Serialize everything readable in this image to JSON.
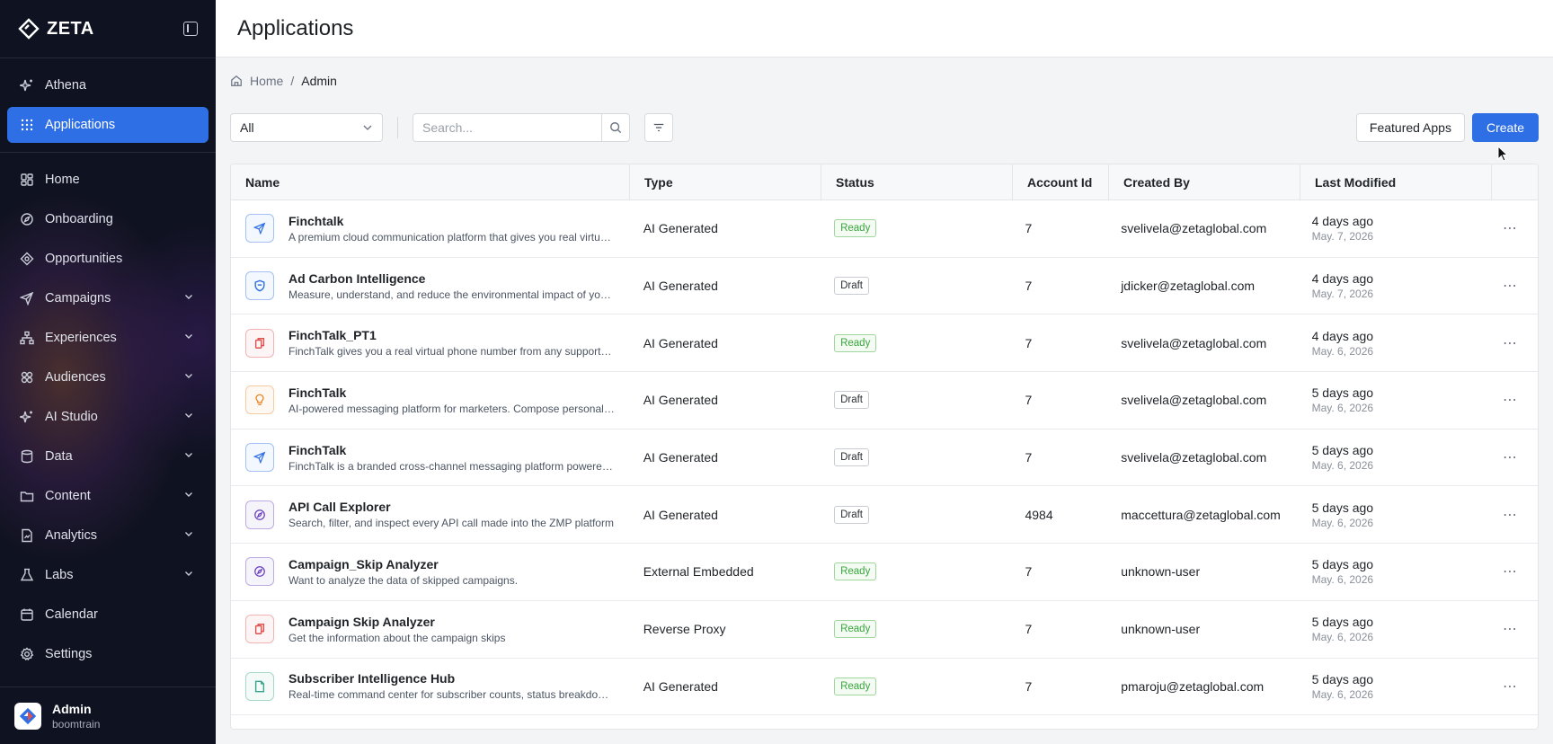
{
  "brand": {
    "name": "ZETA"
  },
  "sidebar": {
    "top_items": [
      {
        "label": "Athena",
        "icon": "sparkle-icon",
        "active": false,
        "chevron": false
      },
      {
        "label": "Applications",
        "icon": "grid-icon",
        "active": true,
        "chevron": false
      }
    ],
    "items": [
      {
        "label": "Home",
        "icon": "dashboard-icon",
        "chevron": false
      },
      {
        "label": "Onboarding",
        "icon": "compass-icon",
        "chevron": false
      },
      {
        "label": "Opportunities",
        "icon": "target-icon",
        "chevron": false
      },
      {
        "label": "Campaigns",
        "icon": "send-icon",
        "chevron": true
      },
      {
        "label": "Experiences",
        "icon": "flow-icon",
        "chevron": true
      },
      {
        "label": "Audiences",
        "icon": "people-icon",
        "chevron": true
      },
      {
        "label": "AI Studio",
        "icon": "sparkle-icon",
        "chevron": true
      },
      {
        "label": "Data",
        "icon": "database-icon",
        "chevron": true
      },
      {
        "label": "Content",
        "icon": "folder-icon",
        "chevron": true
      },
      {
        "label": "Analytics",
        "icon": "report-icon",
        "chevron": true
      },
      {
        "label": "Labs",
        "icon": "labs-icon",
        "chevron": true
      },
      {
        "label": "Calendar",
        "icon": "calendar-icon",
        "chevron": false
      },
      {
        "label": "Settings",
        "icon": "gear-icon",
        "chevron": false
      }
    ],
    "user": {
      "name": "Admin",
      "org": "boomtrain"
    }
  },
  "header": {
    "title": "Applications"
  },
  "breadcrumb": {
    "home": "Home",
    "separator": "/",
    "current": "Admin"
  },
  "toolbar": {
    "filter_value": "All",
    "search_placeholder": "Search...",
    "featured_label": "Featured Apps",
    "create_label": "Create"
  },
  "table": {
    "columns": [
      "Name",
      "Type",
      "Status",
      "Account Id",
      "Created By",
      "Last Modified"
    ],
    "rows": [
      {
        "name": "Finchtalk",
        "desc": "A premium cloud communication platform that gives you real virtual phone numbers",
        "type": "AI Generated",
        "status": "Ready",
        "account": "7",
        "by": "svelivela@zetaglobal.com",
        "rel": "4 days ago",
        "date": "May. 7, 2026",
        "icon": "send-icon",
        "color": "#2f6fe6"
      },
      {
        "name": "Ad Carbon Intelligence",
        "desc": "Measure, understand, and reduce the environmental impact of your advertising",
        "type": "AI Generated",
        "status": "Draft",
        "account": "7",
        "by": "jdicker@zetaglobal.com",
        "rel": "4 days ago",
        "date": "May. 7, 2026",
        "icon": "shield-icon",
        "color": "#2f6fe6"
      },
      {
        "name": "FinchTalk_PT1",
        "desc": "FinchTalk gives you a real virtual phone number from any supported country",
        "type": "AI Generated",
        "status": "Ready",
        "account": "7",
        "by": "svelivela@zetaglobal.com",
        "rel": "4 days ago",
        "date": "May. 6, 2026",
        "icon": "phone-icon",
        "color": "#e0524f"
      },
      {
        "name": "FinchTalk",
        "desc": "AI-powered messaging platform for marketers. Compose personalized messages",
        "type": "AI Generated",
        "status": "Draft",
        "account": "7",
        "by": "svelivela@zetaglobal.com",
        "rel": "5 days ago",
        "date": "May. 6, 2026",
        "icon": "bulb-icon",
        "color": "#e88a2e"
      },
      {
        "name": "FinchTalk",
        "desc": "FinchTalk is a branded cross-channel messaging platform powered by AI",
        "type": "AI Generated",
        "status": "Draft",
        "account": "7",
        "by": "svelivela@zetaglobal.com",
        "rel": "5 days ago",
        "date": "May. 6, 2026",
        "icon": "send-icon",
        "color": "#2f6fe6"
      },
      {
        "name": "API Call Explorer",
        "desc": "Search, filter, and inspect every API call made into the ZMP platform",
        "type": "AI Generated",
        "status": "Draft",
        "account": "4984",
        "by": "maccettura@zetaglobal.com",
        "rel": "5 days ago",
        "date": "May. 6, 2026",
        "icon": "compass-icon",
        "color": "#6a3fc2"
      },
      {
        "name": "Campaign_Skip Analyzer",
        "desc": "Want to analyze the data of skipped campaigns.",
        "type": "External Embedded",
        "status": "Ready",
        "account": "7",
        "by": "unknown-user",
        "rel": "5 days ago",
        "date": "May. 6, 2026",
        "icon": "compass-icon",
        "color": "#6a3fc2"
      },
      {
        "name": "Campaign Skip Analyzer",
        "desc": "Get the information about the campaign skips",
        "type": "Reverse Proxy",
        "status": "Ready",
        "account": "7",
        "by": "unknown-user",
        "rel": "5 days ago",
        "date": "May. 6, 2026",
        "icon": "phone-icon",
        "color": "#e0524f"
      },
      {
        "name": "Subscriber Intelligence Hub",
        "desc": "Real-time command center for subscriber counts, status breakdowns and trends",
        "type": "AI Generated",
        "status": "Ready",
        "account": "7",
        "by": "pmaroju@zetaglobal.com",
        "rel": "5 days ago",
        "date": "May. 6, 2026",
        "icon": "file-icon",
        "color": "#3aa58a"
      }
    ]
  },
  "colors": {
    "accent": "#2f6fe6",
    "sidebar_bg": "#0f1220",
    "ready": "#3aa53e"
  }
}
